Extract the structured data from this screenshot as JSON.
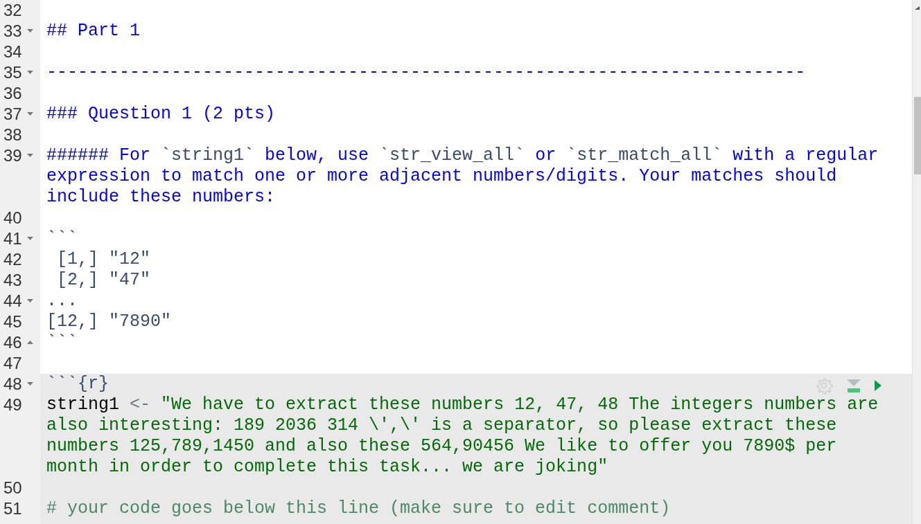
{
  "blocks": [
    {
      "chunk": false,
      "lines": [
        {
          "number": "32",
          "fold_start": false,
          "fold_end": false
        },
        {
          "number": "33",
          "fold_start": true,
          "fold_end": false,
          "segments": [
            {
              "kind": "heading",
              "text": "## Part 1"
            }
          ]
        },
        {
          "number": "34",
          "fold_start": false,
          "fold_end": false
        },
        {
          "number": "35",
          "fold_start": true,
          "fold_end": false,
          "segments": [
            {
              "kind": "heading",
              "text": "-------------------------------------------------------------------------"
            }
          ]
        },
        {
          "number": "36",
          "fold_start": false,
          "fold_end": false
        },
        {
          "number": "37",
          "fold_start": true,
          "fold_end": false,
          "segments": [
            {
              "kind": "heading",
              "text": "### Question 1 (2 pts)"
            }
          ]
        },
        {
          "number": "38",
          "fold_start": false,
          "fold_end": false
        },
        {
          "number": "39",
          "fold_start": true,
          "fold_end": false,
          "segments": [
            {
              "kind": "heading",
              "text": "###### For "
            },
            {
              "kind": "code",
              "text": "`string1`"
            },
            {
              "kind": "heading",
              "text": " below, use "
            },
            {
              "kind": "code",
              "text": "`str_view_all`"
            },
            {
              "kind": "heading",
              "text": " or "
            },
            {
              "kind": "code",
              "text": "`str_match_all`"
            },
            {
              "kind": "heading",
              "text": " with a regular expression to match one or more adjacent numbers/digits. Your matches should include these numbers:"
            }
          ]
        },
        {
          "number": "40",
          "fold_start": false,
          "fold_end": false
        },
        {
          "number": "41",
          "fold_start": true,
          "fold_end": false,
          "segments": [
            {
              "kind": "code",
              "text": "```"
            }
          ]
        },
        {
          "number": "42",
          "fold_start": false,
          "fold_end": false,
          "segments": [
            {
              "kind": "code",
              "text": " [1,] \"12\""
            }
          ]
        },
        {
          "number": "43",
          "fold_start": false,
          "fold_end": false,
          "segments": [
            {
              "kind": "code",
              "text": " [2,] \"47\""
            }
          ]
        },
        {
          "number": "44",
          "fold_start": true,
          "fold_end": false,
          "segments": [
            {
              "kind": "code",
              "text": "..."
            }
          ]
        },
        {
          "number": "45",
          "fold_start": false,
          "fold_end": false,
          "segments": [
            {
              "kind": "code",
              "text": "[12,] \"7890\""
            }
          ]
        },
        {
          "number": "46",
          "fold_start": false,
          "fold_end": true,
          "segments": [
            {
              "kind": "code",
              "text": "```"
            }
          ]
        },
        {
          "number": "47",
          "fold_start": false,
          "fold_end": false
        }
      ]
    },
    {
      "chunk": true,
      "lines": [
        {
          "number": "48",
          "fold_start": true,
          "fold_end": false,
          "segments": [
            {
              "kind": "code",
              "text": "```{r}"
            }
          ]
        },
        {
          "number": "49",
          "fold_start": false,
          "fold_end": false,
          "segments": [
            {
              "kind": "identifier",
              "text": "string1"
            },
            {
              "kind": "operator",
              "text": " <- "
            },
            {
              "kind": "string",
              "text": "\"We have to extract these numbers 12, 47, 48 The integers numbers are also interesting: 189 2036 314 \\',\\' is a separator, so please extract these numbers 125,789,1450 and also these 564,90456 We like to offer you 7890$ per month in order to complete this task... we are joking\""
            }
          ]
        },
        {
          "number": "50",
          "fold_start": false,
          "fold_end": false
        },
        {
          "number": "51",
          "fold_start": false,
          "fold_end": false,
          "segments": [
            {
              "kind": "comment",
              "text": "# your code goes below this line (make sure to edit comment)"
            }
          ]
        }
      ]
    }
  ]
}
